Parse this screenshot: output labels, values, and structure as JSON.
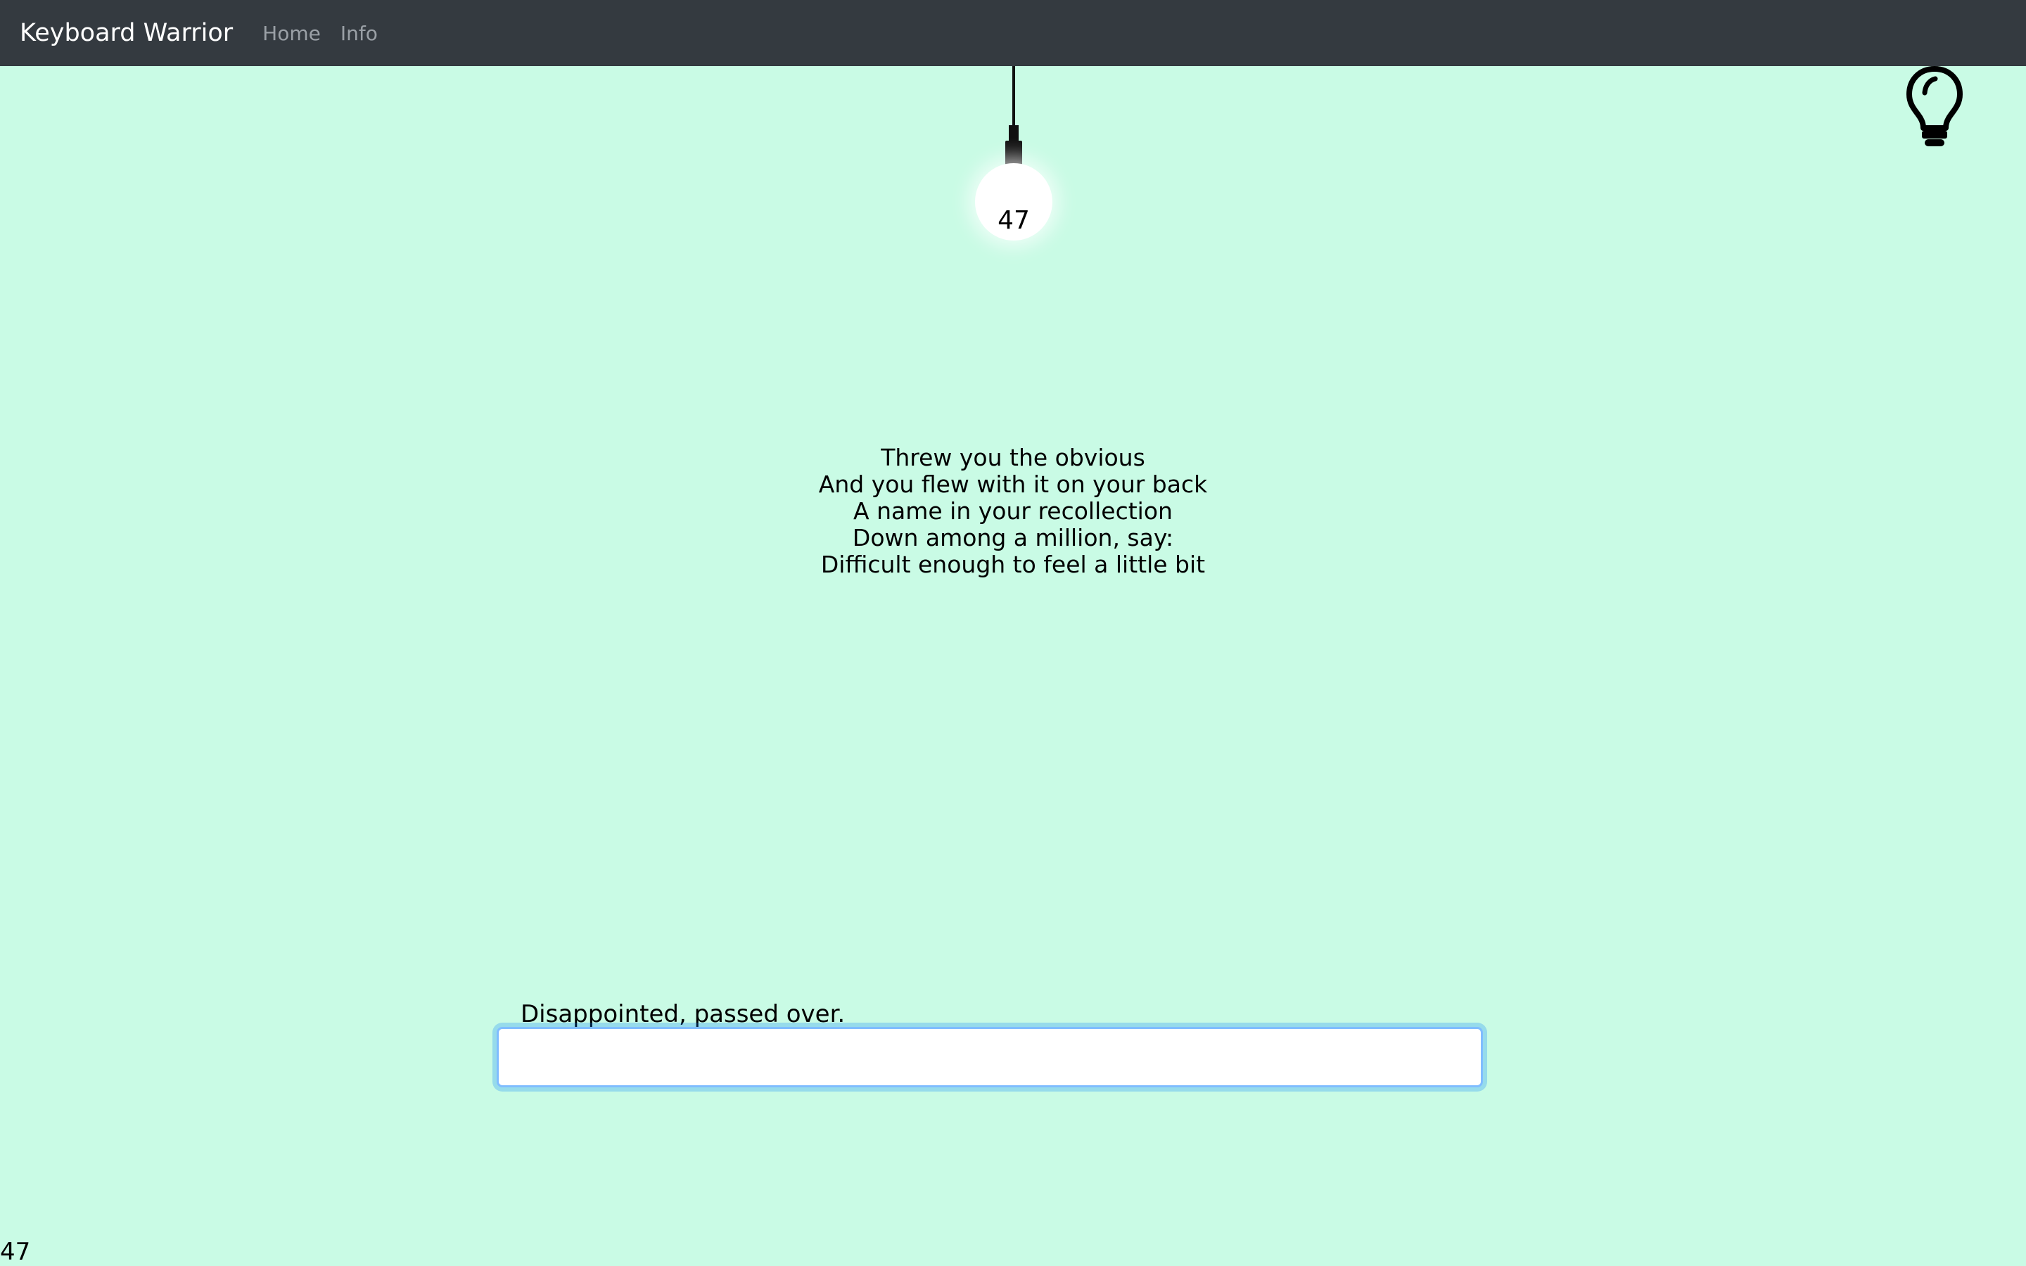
{
  "navbar": {
    "brand": "Keyboard Warrior",
    "links": [
      "Home",
      "Info"
    ]
  },
  "bulb": {
    "count": "47"
  },
  "hint": {
    "icon": "lightbulb-icon"
  },
  "lyrics": {
    "lines": [
      "Threw you the obvious",
      "And you flew with it on your back",
      "A name in your recollection",
      "Down among a million, say:",
      "Difficult enough to feel a little bit"
    ]
  },
  "prompt": {
    "text": "Disappointed, passed over."
  },
  "input": {
    "value": "",
    "placeholder": ""
  },
  "footer": {
    "count": "47"
  },
  "colors": {
    "background": "#c9fbe5",
    "navbar": "#343a40",
    "brand_text": "#ffffff",
    "nav_link": "#9aa0a6",
    "input_focus": "#80bdff"
  }
}
